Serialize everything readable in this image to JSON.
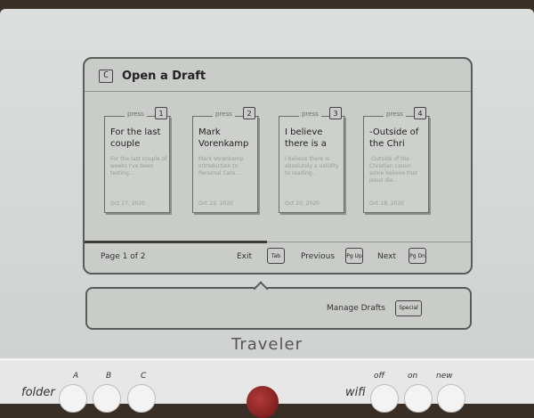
{
  "screen": {
    "title": "Open a Draft",
    "folder_icon": "C",
    "drafts": [
      {
        "press": "press",
        "num": "1",
        "title": "For the last couple",
        "preview": "For the last couple of weeks I've been testing...",
        "date": "Oct 27, 2020"
      },
      {
        "press": "press",
        "num": "2",
        "title": "Mark Vorenkamp",
        "preview": "Mark Vorenkamp Introduction to Personal Care...",
        "date": "Oct 22, 2020"
      },
      {
        "press": "press",
        "num": "3",
        "title": "I believe there is a",
        "preview": "I believe there is absolutely a validity to reading...",
        "date": "Oct 20, 2020"
      },
      {
        "press": "press",
        "num": "4",
        "title": "-Outside of the Chri",
        "preview": "-Outside of the Christian canon some believe that Jesus die...",
        "date": "Oct 18, 2020"
      }
    ],
    "footer": {
      "page": "Page 1 of 2",
      "progress": 0.5,
      "exit": "Exit",
      "exit_key": "Tab",
      "previous": "Previous",
      "previous_key": "Pg Up",
      "next": "Next",
      "next_key": "Pg Dn"
    }
  },
  "secondary": {
    "manage": "Manage Drafts",
    "special_key": "Special"
  },
  "brand": "Traveler",
  "keyboard": {
    "folder": "folder",
    "a": "A",
    "b": "B",
    "c": "C",
    "wifi": "wifi",
    "off": "off",
    "on": "on",
    "new": "new"
  }
}
